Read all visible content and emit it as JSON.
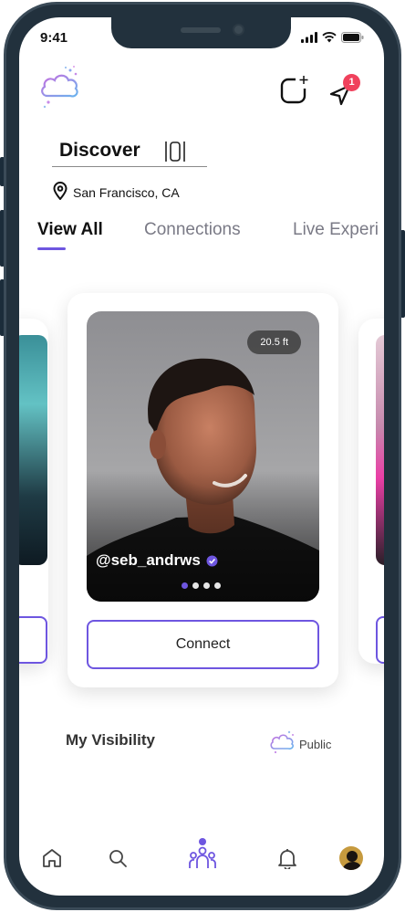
{
  "status_bar": {
    "time": "9:41"
  },
  "header": {
    "logo_icon": "cloud-logo-icon",
    "add_story_icon": "add-story-icon",
    "notification_icon": "send-icon",
    "notification_count": "1",
    "badge_color": "#f0415c"
  },
  "discover": {
    "title": "Discover",
    "location": "San Francisco, CA"
  },
  "tabs": [
    {
      "label": "View All",
      "active": true
    },
    {
      "label": "Connections",
      "active": false
    },
    {
      "label": "Live Experi",
      "active": false
    }
  ],
  "card": {
    "distance": "20.5 ft",
    "username": "@seb_andrws",
    "verified": true,
    "photo_count": 4,
    "active_photo": 1,
    "connect_label": "Connect"
  },
  "visibility": {
    "label": "My Visibility",
    "value": "Public"
  },
  "nav": {
    "items": [
      "home-icon",
      "search-icon",
      "community-icon",
      "bell-icon",
      "profile-avatar"
    ],
    "active": "community-icon"
  },
  "colors": {
    "accent": "#6e56e0",
    "frame": "#22313d"
  }
}
